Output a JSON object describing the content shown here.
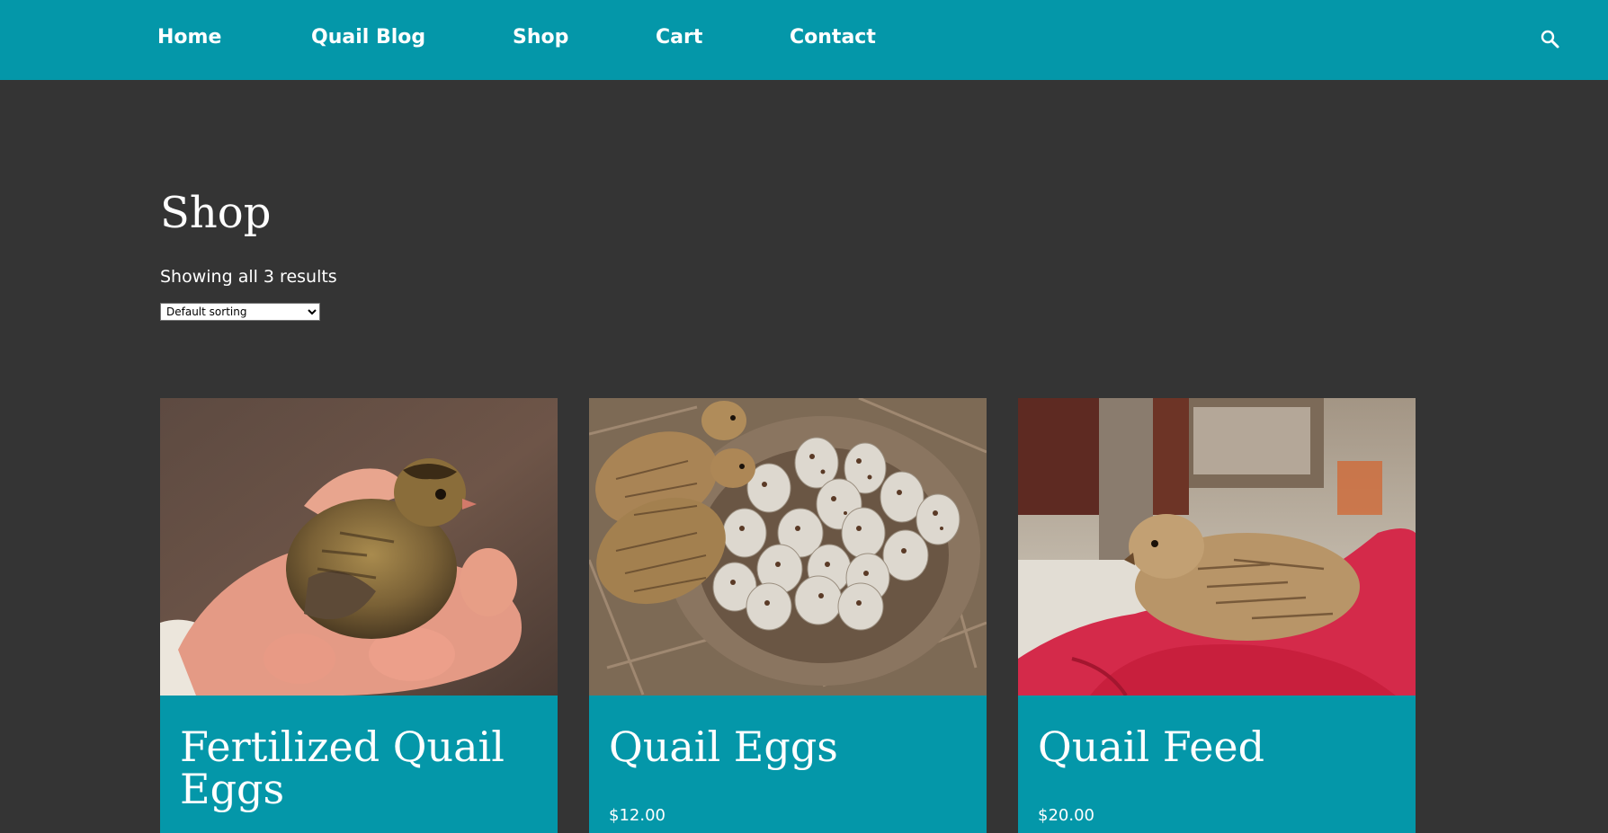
{
  "nav": {
    "items": [
      {
        "label": "Home"
      },
      {
        "label": "Quail Blog"
      },
      {
        "label": "Shop"
      },
      {
        "label": "Cart"
      },
      {
        "label": "Contact"
      }
    ],
    "search_icon": "search-icon"
  },
  "page": {
    "title": "Shop",
    "result_count": "Showing all 3 results",
    "sort": {
      "selected": "Default sorting"
    }
  },
  "products": [
    {
      "title": "Fertilized Quail Eggs",
      "price": "",
      "image": "quail-chick-in-hand"
    },
    {
      "title": "Quail Eggs",
      "price": "$12.00",
      "image": "quail-nest-with-eggs"
    },
    {
      "title": "Quail Feed",
      "price": "$20.00",
      "image": "quail-on-red-cloth"
    }
  ],
  "colors": {
    "header": "#0497a9",
    "background": "#343434",
    "card": "#0497a9",
    "text": "#ffffff"
  }
}
